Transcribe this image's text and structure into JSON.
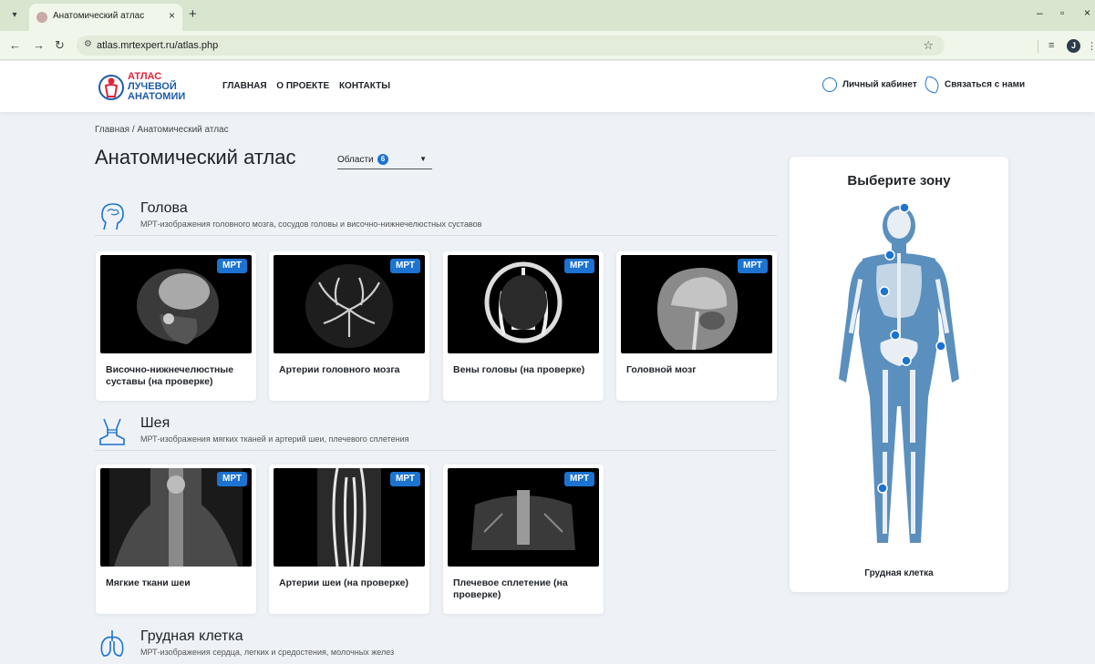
{
  "browser": {
    "tab_title": "Анатомический атлас",
    "tab_close": "×",
    "new_tab": "+",
    "url": "atlas.mrtexpert.ru/atlas.php",
    "profile_initial": "J"
  },
  "header": {
    "logo_lines": [
      "АТЛАС",
      "ЛУЧЕВОЙ",
      "АНАТОМИИ"
    ],
    "nav": [
      "ГЛАВНАЯ",
      "О ПРОЕКТЕ",
      "КОНТАКТЫ"
    ],
    "account": "Личный кабинет",
    "contact": "Связаться с нами"
  },
  "breadcrumb": "Главная  /  Анатомический атлас",
  "page_title": "Анатомический атлас",
  "region_select": {
    "label": "Области",
    "count": "6"
  },
  "sections": [
    {
      "title": "Голова",
      "subtitle": "МРТ-изображения головного мозга, сосудов головы и височно-нижнечелюстных суставов",
      "cards": [
        {
          "badge": "МРТ",
          "label": "Височно-нижнечелюстные суставы (на проверке)"
        },
        {
          "badge": "МРТ",
          "label": "Артерии головного мозга"
        },
        {
          "badge": "МРТ",
          "label": "Вены головы (на проверке)"
        },
        {
          "badge": "МРТ",
          "label": "Головной мозг"
        }
      ]
    },
    {
      "title": "Шея",
      "subtitle": "МРТ-изображения мягких тканей и артерий шеи, плечевого сплетения",
      "cards": [
        {
          "badge": "МРТ",
          "label": "Мягкие ткани шеи"
        },
        {
          "badge": "МРТ",
          "label": "Артерии шеи (на проверке)"
        },
        {
          "badge": "МРТ",
          "label": "Плечевое сплетение (на проверке)"
        }
      ]
    },
    {
      "title": "Грудная клетка",
      "subtitle": "МРТ-изображения сердца, легких и средостения, молочных желез",
      "cards": []
    }
  ],
  "zone_panel": {
    "title": "Выберите зону",
    "caption": "Грудная клетка"
  },
  "colors": {
    "accent": "#1c73d1",
    "logo_red": "#e0233a",
    "logo_blue": "#1c5ba8",
    "page_bg": "#eef2f6"
  }
}
